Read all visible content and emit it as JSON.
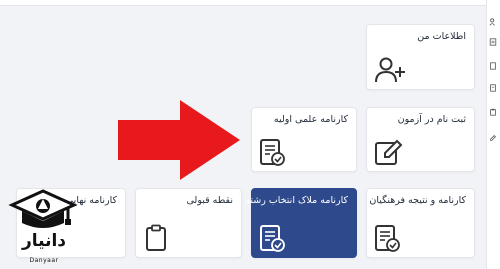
{
  "cards": {
    "my_info": "اطلاعات من",
    "exam_registration": "ثبت نام در آزمون",
    "initial_report": "کارنامه علمی اولیه",
    "final_report": "کارنامه نهایی",
    "acceptance_point": "نقطه قبولی",
    "selection_report": "کارنامه ملاک انتخاب رشته",
    "farhangian_report": "کارنامه و نتیجه فرهنگیان"
  },
  "logo": {
    "name": "دانیار",
    "name_en": "Danyaar"
  },
  "colors": {
    "active_card": "#2e4a8c",
    "arrow": "#e8191c"
  },
  "icons": [
    "user-plus-icon",
    "edit-icon",
    "report-card-icon",
    "clipboard-icon"
  ]
}
